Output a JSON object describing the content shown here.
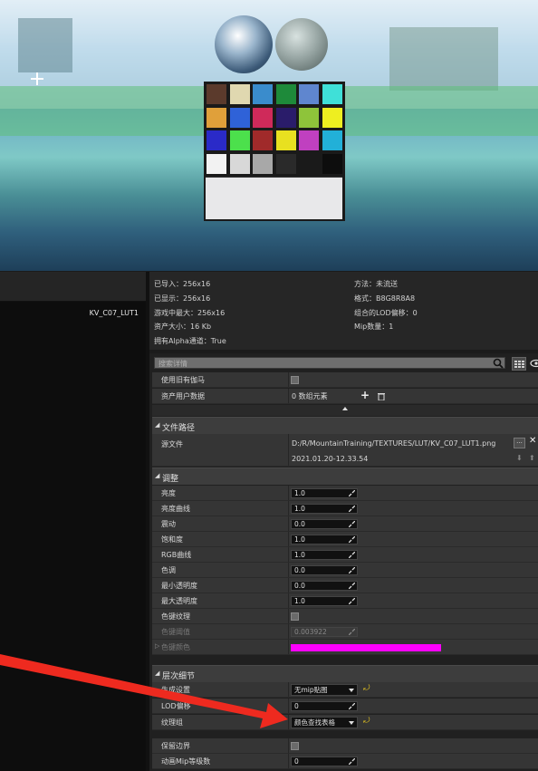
{
  "colors": {
    "accent_pink": "#ff00ff",
    "arrow_red": "#ee2a1f"
  },
  "viewport": {
    "chart_swatches": [
      [
        "#5b3a2c",
        "#e0d8b0",
        "#3a8ccc",
        "#1e8a3a",
        "#5f86cf",
        "#3fe0d8"
      ],
      [
        "#e0a03a",
        "#2f62d8",
        "#cf2a5a",
        "#2a1c6a",
        "#8ec43a",
        "#eeee20"
      ],
      [
        "#2a2ac8",
        "#4ce04c",
        "#a02a2a",
        "#e8e020",
        "#c040c0",
        "#22b0d8"
      ],
      [
        "#f2f2f2",
        "#d8d8d8",
        "#a8a8a8",
        "#2a2a2a",
        "#1a1a1a",
        "#0d0d0d"
      ]
    ]
  },
  "left_panel": {
    "asset_name": "KV_C07_LUT1"
  },
  "info": {
    "imported": "已导入：256x16",
    "displayed": "已显示：256x16",
    "max_ingame": "游戏中最大：256x16",
    "resource_size": "资产大小：16 Kb",
    "has_alpha": "拥有Alpha通道：True",
    "method": "方法：未流送",
    "format": "格式：B8G8R8A8",
    "lod_bias": "组合的LOD偏移：0",
    "mip_count": "Mip数量：1"
  },
  "search": {
    "placeholder": "搜索详情"
  },
  "rows_top": {
    "use_legacy_gamma": "使用旧有伽马",
    "asset_user_data": "资产用户数据",
    "asset_user_data_value": "0 数组元素"
  },
  "file_path": {
    "section": "文件路径",
    "source_file": "源文件",
    "path": "D:/R/MountainTraining/TEXTURES/LUT/KV_C07_LUT1.png",
    "timestamp": "2021.01.20-12.33.54"
  },
  "adjust": {
    "section": "调整",
    "items": [
      {
        "label": "亮度",
        "value": "1.0"
      },
      {
        "label": "亮度曲线",
        "value": "1.0"
      },
      {
        "label": "震动",
        "value": "0.0"
      },
      {
        "label": "饱和度",
        "value": "1.0"
      },
      {
        "label": "RGB曲线",
        "value": "1.0"
      },
      {
        "label": "色调",
        "value": "0.0"
      },
      {
        "label": "最小透明度",
        "value": "0.0"
      },
      {
        "label": "最大透明度",
        "value": "1.0"
      }
    ],
    "chroma_key": "色键纹理",
    "chroma_threshold": "色键阈值",
    "chroma_threshold_value": "0.003922",
    "chroma_color": "色键颜色"
  },
  "lod": {
    "section": "层次细节",
    "mip_gen": "生成设置",
    "mip_gen_value": "无mip贴图",
    "lod_bias": "LOD偏移",
    "lod_bias_value": "0",
    "texture_group": "纹理组",
    "texture_group_value": "颜色查找表格",
    "preserve_border": "保留边界",
    "mip_load": "动画Mip等级数",
    "mip_load_value": "0"
  }
}
